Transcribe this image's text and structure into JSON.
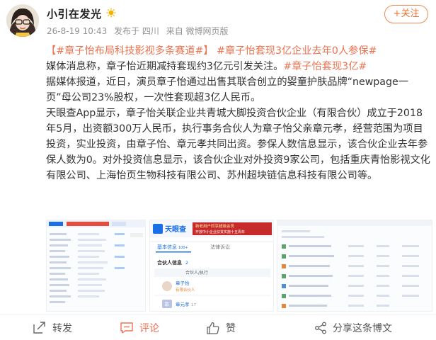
{
  "user": {
    "name": "小引在发光",
    "timestamp": "26-8-19 10:43",
    "published_from": "发布于 四川",
    "source": "来自 微博网页版",
    "follow_label": "+关注"
  },
  "post": {
    "tag1": "#章子怡布局科技影视多条赛道#",
    "tag1_close": "】",
    "tag1_open": "【",
    "tag2": "#章子怡套现3亿企业去年0人参保#",
    "line2_text": "媒体消息称，章子怡近期减持套现约3亿元引发关注。",
    "tag3": "#章子怡套现3亿#",
    "p2": "据媒体报道，近日，演员章子怡通过出售其联合创立的婴童护肤品牌“newpage一页”母公司23%股权，一次性套现超3亿人民币。",
    "p3": "天眼查App显示，章子怡关联企业共青城大脚投资合伙企业（有限合伙）成立于2018年5月，出资额300万人民币，执行事务合伙人为章子怡父亲章元孝，经营范围为项目投资，实业投资，由章子怡、章元孝共同出资。参保人数信息显示，该合伙企业去年参保人数为0。对外投资信息显示，该合伙企业对外投资9家公司，包括重庆青怡影视文化有限公司、上海怡页生物科技有限公司、苏州超块链信息科技有限公司等。"
  },
  "screenshot2": {
    "brand": "天眼查",
    "ad_text1": "新老用户同享超级会员",
    "ad_text2": "开放中小企业扶贫实施十五周年",
    "tab_basic": "基本信息",
    "tab_basic_count": "100+",
    "tab_legal": "法律诉讼",
    "partner_section": "合伙人信息",
    "partner_count": "2",
    "partner_header": "合伙人/执行",
    "partner1_name": "章子怡",
    "partner1_role": "有限合伙人",
    "partner2_initial": "章",
    "partner2_name": "章元孝",
    "partner2_count": "17"
  },
  "footer": {
    "repost": "转发",
    "comment": "评论",
    "like": "赞",
    "share": "分享这条博文"
  },
  "colors": {
    "accent": "#eb7350",
    "follow": "#f0702f",
    "tyc_blue": "#1a6ee6"
  }
}
